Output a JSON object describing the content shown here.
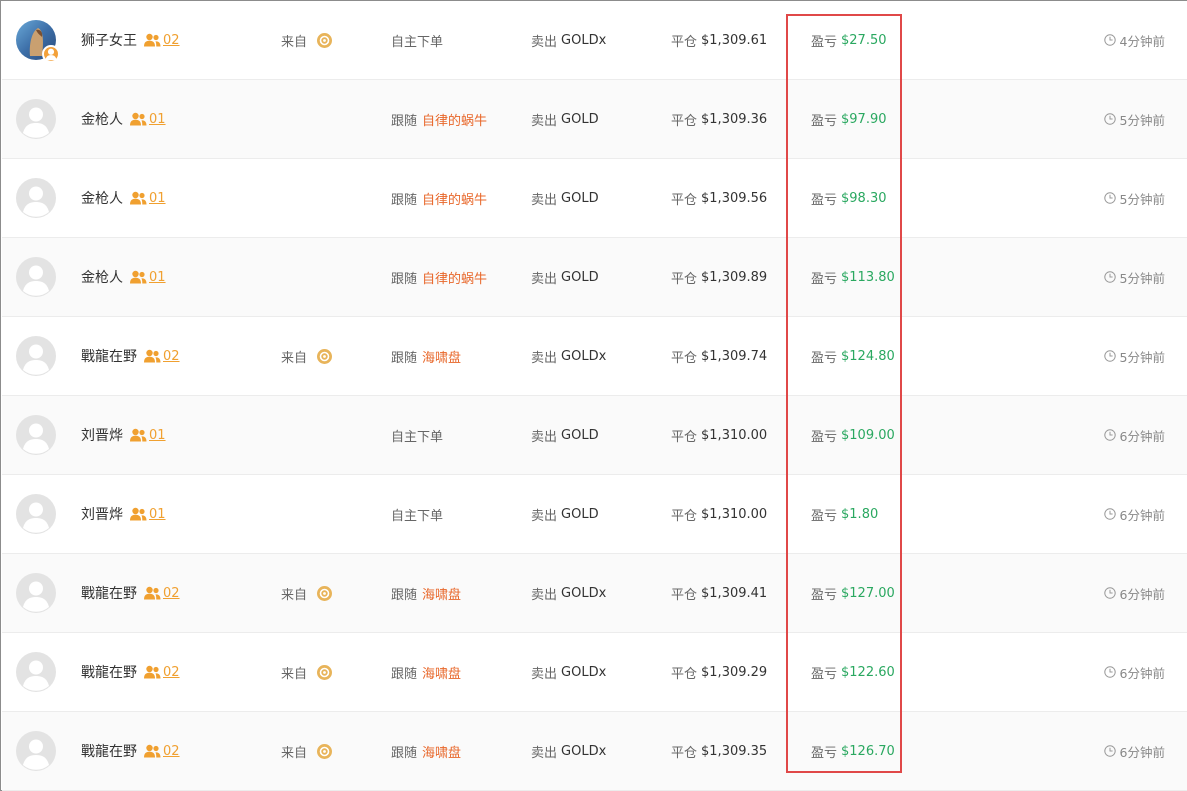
{
  "labels": {
    "source_prefix": "来自",
    "follow_prefix": "跟随",
    "sell_prefix": "卖出",
    "close_prefix": "平仓",
    "pnl_prefix": "盈亏"
  },
  "colors": {
    "accent_orange": "#f0a030",
    "follow_target": "#e8672a",
    "profit_green": "#2aa860",
    "highlight_red": "#e04848"
  },
  "rows": [
    {
      "name": "狮子女王",
      "follow_count": "02",
      "avatar": "photo",
      "has_source": true,
      "mode": "自主下单",
      "target": "",
      "symbol": "GOLDx",
      "close_price": "$1,309.61",
      "pnl": "$27.50",
      "time": "4分钟前"
    },
    {
      "name": "金枪人",
      "follow_count": "01",
      "avatar": "default",
      "has_source": false,
      "mode": "跟随",
      "target": "自律的蜗牛",
      "symbol": "GOLD",
      "close_price": "$1,309.36",
      "pnl": "$97.90",
      "time": "5分钟前"
    },
    {
      "name": "金枪人",
      "follow_count": "01",
      "avatar": "default",
      "has_source": false,
      "mode": "跟随",
      "target": "自律的蜗牛",
      "symbol": "GOLD",
      "close_price": "$1,309.56",
      "pnl": "$98.30",
      "time": "5分钟前"
    },
    {
      "name": "金枪人",
      "follow_count": "01",
      "avatar": "default",
      "has_source": false,
      "mode": "跟随",
      "target": "自律的蜗牛",
      "symbol": "GOLD",
      "close_price": "$1,309.89",
      "pnl": "$113.80",
      "time": "5分钟前"
    },
    {
      "name": "戰龍在野",
      "follow_count": "02",
      "avatar": "default",
      "has_source": true,
      "mode": "跟随",
      "target": "海啸盘",
      "symbol": "GOLDx",
      "close_price": "$1,309.74",
      "pnl": "$124.80",
      "time": "5分钟前"
    },
    {
      "name": "刘晋烨",
      "follow_count": "01",
      "avatar": "default",
      "has_source": false,
      "mode": "自主下单",
      "target": "",
      "symbol": "GOLD",
      "close_price": "$1,310.00",
      "pnl": "$109.00",
      "time": "6分钟前"
    },
    {
      "name": "刘晋烨",
      "follow_count": "01",
      "avatar": "default",
      "has_source": false,
      "mode": "自主下单",
      "target": "",
      "symbol": "GOLD",
      "close_price": "$1,310.00",
      "pnl": "$1.80",
      "time": "6分钟前"
    },
    {
      "name": "戰龍在野",
      "follow_count": "02",
      "avatar": "default",
      "has_source": true,
      "mode": "跟随",
      "target": "海啸盘",
      "symbol": "GOLDx",
      "close_price": "$1,309.41",
      "pnl": "$127.00",
      "time": "6分钟前"
    },
    {
      "name": "戰龍在野",
      "follow_count": "02",
      "avatar": "default",
      "has_source": true,
      "mode": "跟随",
      "target": "海啸盘",
      "symbol": "GOLDx",
      "close_price": "$1,309.29",
      "pnl": "$122.60",
      "time": "6分钟前"
    },
    {
      "name": "戰龍在野",
      "follow_count": "02",
      "avatar": "default",
      "has_source": true,
      "mode": "跟随",
      "target": "海啸盘",
      "symbol": "GOLDx",
      "close_price": "$1,309.35",
      "pnl": "$126.70",
      "time": "6分钟前"
    }
  ]
}
